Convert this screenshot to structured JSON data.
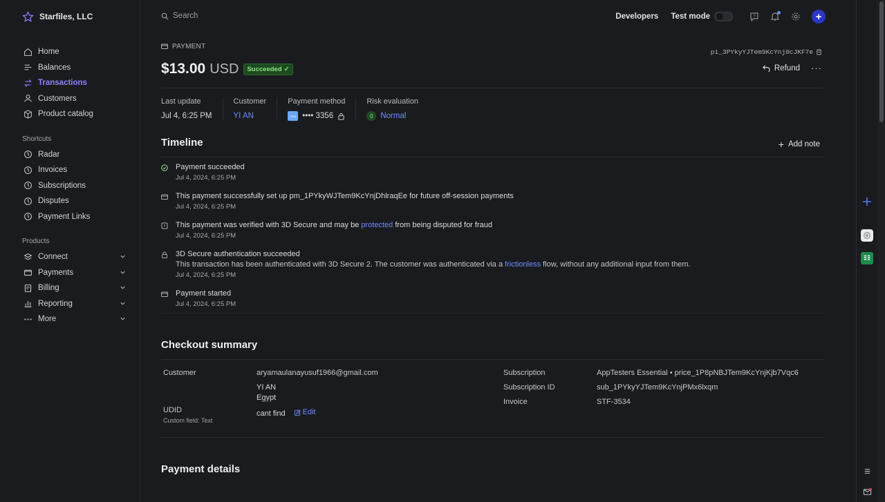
{
  "colors": {
    "accent": "#8b83ff",
    "link": "#6f8cff",
    "success": "#8fe28a",
    "background": "#1a1b1f"
  },
  "sidebar": {
    "brand": "Starfiles, LLC",
    "items": [
      {
        "label": "Home",
        "icon": "home-icon"
      },
      {
        "label": "Balances",
        "icon": "balances-icon"
      },
      {
        "label": "Transactions",
        "icon": "transactions-icon",
        "active": true
      },
      {
        "label": "Customers",
        "icon": "person-icon"
      },
      {
        "label": "Product catalog",
        "icon": "box-icon"
      }
    ],
    "shortcuts_label": "Shortcuts",
    "shortcuts": [
      "Radar",
      "Invoices",
      "Subscriptions",
      "Disputes",
      "Payment Links"
    ],
    "products_label": "Products",
    "products": [
      "Connect",
      "Payments",
      "Billing",
      "Reporting",
      "More"
    ]
  },
  "topbar": {
    "search_placeholder": "Search",
    "developers": "Developers",
    "test_mode": "Test mode"
  },
  "payment": {
    "label": "PAYMENT",
    "id": "pi_3PYkyYJTem9KcYnj0cJKF7e",
    "amount": "$13.00",
    "currency": "USD",
    "status": "Succeeded",
    "refund_label": "Refund",
    "more_label": "···"
  },
  "meta": {
    "last_update_label": "Last update",
    "last_update": "Jul 4, 6:25 PM",
    "customer_label": "Customer",
    "customer": "YI AN",
    "payment_method_label": "Payment method",
    "card_brand": "VISA",
    "card_last4": "•••• 3356",
    "risk_label": "Risk evaluation",
    "risk_score": "0",
    "risk_value": "Normal"
  },
  "timeline": {
    "title": "Timeline",
    "add_note": "Add note",
    "events": [
      {
        "title": "Payment succeeded",
        "date": "Jul 4, 2024, 6:25 PM"
      },
      {
        "title": "This payment successfully set up pm_1PYkyWJTem9KcYnjDhlraqEe for future off-session payments",
        "date": "Jul 4, 2024, 6:25 PM"
      },
      {
        "title_pre": "This payment was verified with 3D Secure and may be ",
        "title_link": "protected",
        "title_post": " from being disputed for fraud",
        "date": "Jul 4, 2024, 6:25 PM"
      },
      {
        "title": "3D Secure authentication succeeded",
        "desc_pre": "This transaction has been authenticated with 3D Secure 2. The customer was authenticated via a ",
        "desc_link": "frictionless",
        "desc_post": " flow, without any additional input from them.",
        "date": "Jul 4, 2024, 6:25 PM"
      },
      {
        "title": "Payment started",
        "date": "Jul 4, 2024, 6:25 PM"
      }
    ]
  },
  "checkout": {
    "title": "Checkout summary",
    "customer_label": "Customer",
    "email": "aryamaulanayusuf1966@gmail.com",
    "name": "YI AN",
    "country": "Egypt",
    "udid_label": "UDID",
    "udid_sub": "Custom field: Text",
    "udid_value": "cant find",
    "edit_label": "Edit",
    "subscription_label": "Subscription",
    "subscription_value": "AppTesters Essential • price_1P8pNBJTem9KcYnjKjb7Vqc6",
    "subscription_id_label": "Subscription ID",
    "subscription_id_value": "sub_1PYkyYJTem9KcYnjPMx6lxqm",
    "invoice_label": "Invoice",
    "invoice_value": "STF-3534"
  },
  "payment_details": {
    "title": "Payment details"
  }
}
